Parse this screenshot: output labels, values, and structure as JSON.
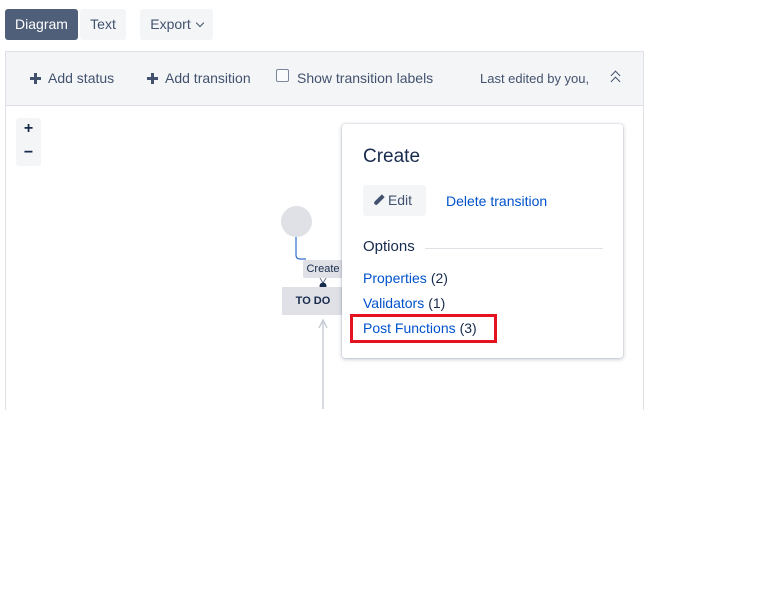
{
  "view_tabs": {
    "diagram": "Diagram",
    "text": "Text",
    "export": "Export"
  },
  "toolbar": {
    "add_status": "Add status",
    "add_transition": "Add transition",
    "show_transition_labels": "Show transition labels",
    "last_edited": "Last edited by you,"
  },
  "zoom": {
    "in": "+",
    "out": "−"
  },
  "diagram": {
    "transition_label": "Create",
    "status": "TO DO"
  },
  "panel": {
    "title": "Create",
    "edit": "Edit",
    "delete": "Delete transition",
    "options_heading": "Options",
    "options": [
      {
        "label": "Properties",
        "count": "(2)"
      },
      {
        "label": "Validators",
        "count": "(1)"
      },
      {
        "label": "Post Functions",
        "count": "(3)"
      }
    ]
  },
  "colors": {
    "accent": "#505f79",
    "link": "#0052cc",
    "highlight": "#e4131f"
  },
  "icons": [
    "plus-icon",
    "chevron-down-icon",
    "double-chevron-up-icon",
    "pencil-icon"
  ]
}
